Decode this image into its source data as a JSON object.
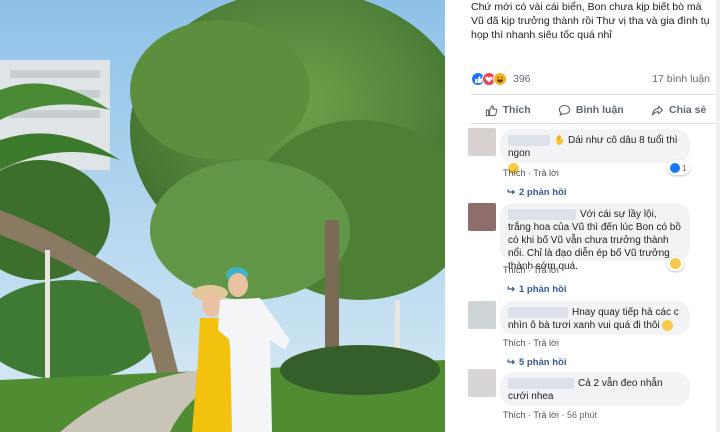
{
  "post": {
    "text": "Chứ mới có vài cái biển, Bon chưa kịp biết bò mà Vũ đã kịp trưởng thành rồi Thư vị tha và gia đình tụ họp thì nhanh siêu tốc quá nhỉ",
    "reaction_count": "396",
    "comment_count": "17 bình luận"
  },
  "actions": {
    "like": "Thích",
    "comment": "Bình luận",
    "share": "Chia sẻ"
  },
  "comments": [
    {
      "text": "Dái như cô dâu 8 tuổi thì ngon",
      "like_label": "Thích",
      "reply_label": "Trả lời",
      "reaction_count": "1",
      "replies_label": "2 phản hồi"
    },
    {
      "text": "Với cái sự lầy lội, trắng hoa của Vũ thì đến lúc Bon có bồ có khi bố Vũ vẫn chưa trưởng thành nổi. Chỉ là đạo diễn ép bố Vũ trưởng thành sớm quá.",
      "like_label": "Thích",
      "reply_label": "Trả lời",
      "replies_label": "1 phản hồi"
    },
    {
      "text": "Hnay quay tiếp hả các c nhìn ô bà tươi xanh vui quá đi thôi",
      "like_label": "Thích",
      "reply_label": "Trả lời",
      "replies_label": "5 phản hồi"
    },
    {
      "text": "Cả 2 vẫn đeo nhẫn cưới nhea",
      "like_label": "Thích",
      "reply_label": "Trả lời",
      "time": "56 phút"
    }
  ],
  "colors": {
    "like_blue": "#1877f2",
    "love_red": "#f33e58",
    "haha_yellow": "#f7b125",
    "link": "#385898"
  }
}
